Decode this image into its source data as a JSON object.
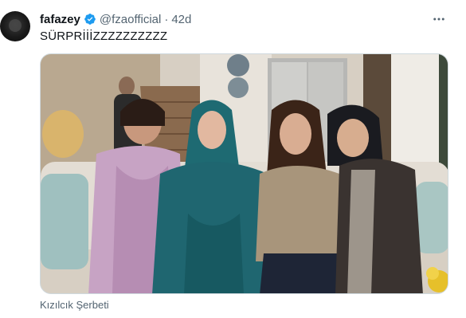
{
  "tweet": {
    "author": {
      "display_name": "fafazey",
      "handle": "@fzaofficial",
      "verified": true
    },
    "separator": "·",
    "time": "42d",
    "text": "SÜRPRİİİZZZZZZZZZZ",
    "media": {
      "caption": "Kızılcık Şerbeti"
    }
  },
  "icons": {
    "verified": "verified-badge-icon",
    "more": "more-options-icon"
  },
  "colors": {
    "primary_text": "#0f1419",
    "secondary_text": "#536471",
    "verified_blue": "#1d9bf0",
    "border": "#cfd9de"
  }
}
